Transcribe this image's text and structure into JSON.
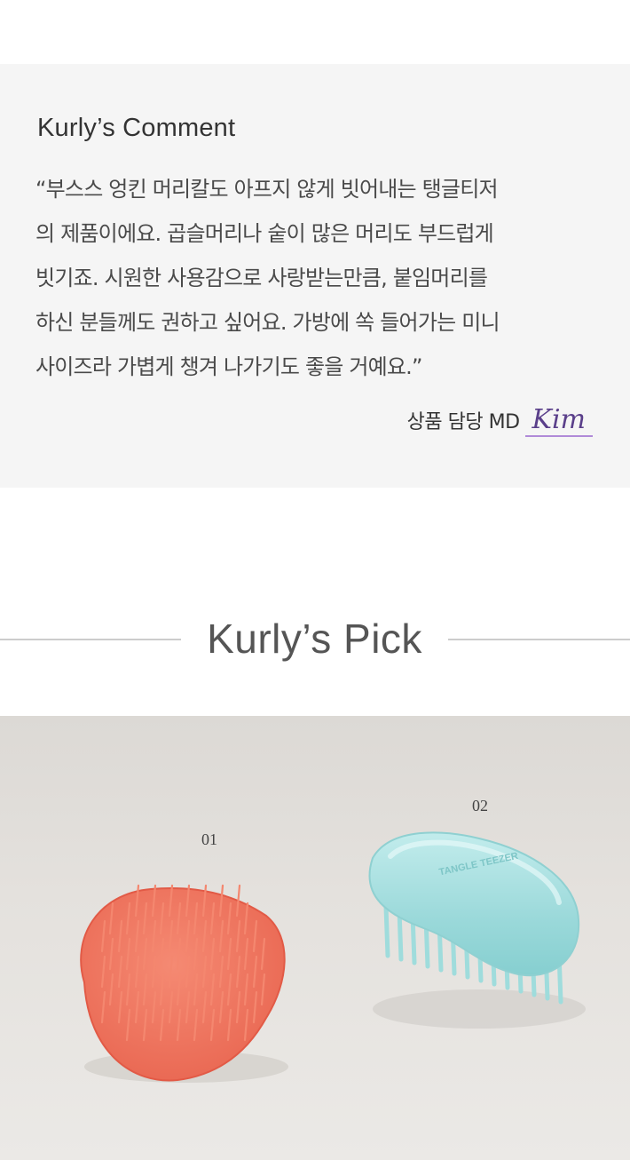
{
  "comment": {
    "title": "Kurly’s Comment",
    "body": "“부스스 엉킨 머리칼도 아프지 않게 빗어내는 탱글티저\n의 제품이에요. 곱슬머리나 숱이 많은 머리도 부드럽게\n빗기죠. 시원한 사용감으로 사랑받는만큼, 붙임머리를\n하신 분들께도 권하고 싶어요. 가방에 쏙 들어가는 미니\n사이즈라 가볍게 챙겨 나가기도 좋을 거예요.”",
    "md_label": "상품 담당 MD",
    "md_signature": "Kim"
  },
  "pick": {
    "title": "Kurly’s Pick"
  },
  "photo": {
    "label_01": "01",
    "label_02": "02",
    "brush_left_color": "#f07862",
    "brush_right_color": "#9ad8d8",
    "brush_right_logo": "TANGLE TEEZER"
  }
}
